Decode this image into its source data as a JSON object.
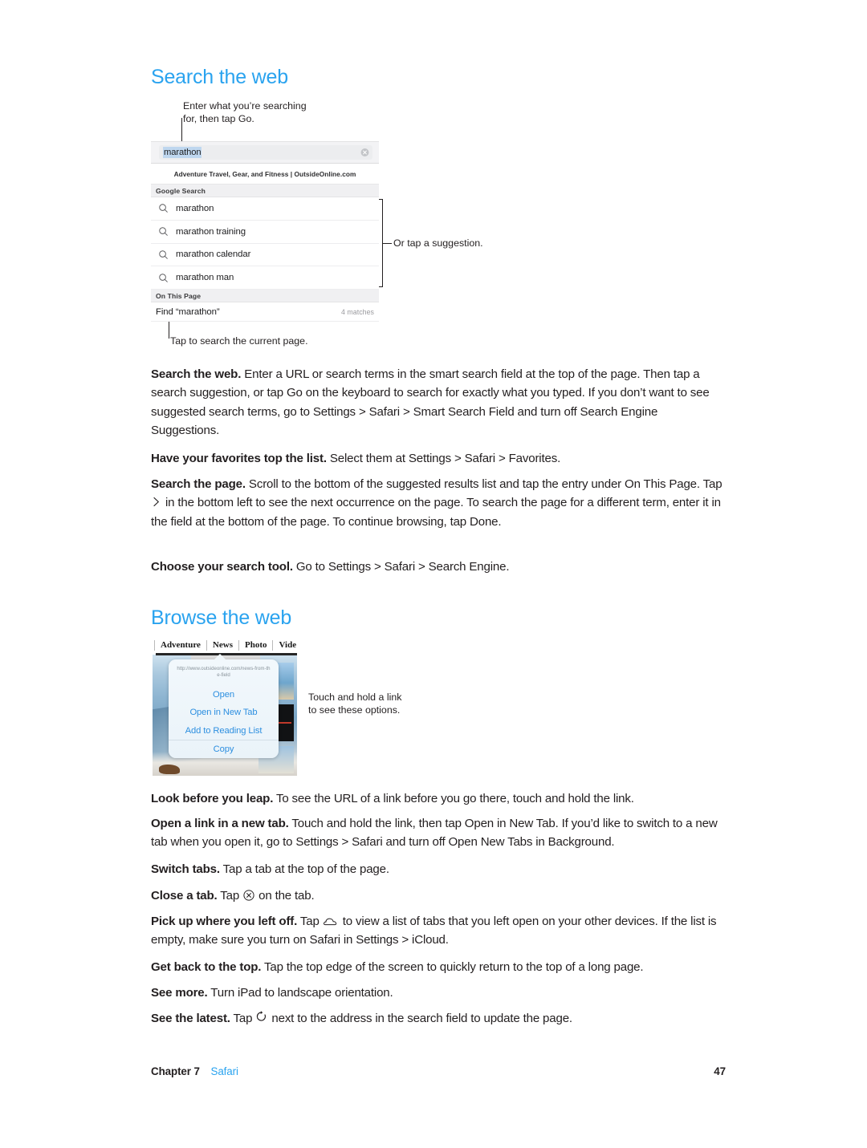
{
  "document": {
    "sections": [
      {
        "id": "search-the-web",
        "heading": "Search the web"
      },
      {
        "id": "browse-the-web",
        "heading": "Browse the web"
      }
    ]
  },
  "colors": {
    "heading_blue": "#2aa3ef",
    "link_blue": "#2d8fe0",
    "body_text": "#231f20",
    "field_gray": "#f3f3f5",
    "selection_blue": "#bfd7ef"
  },
  "figure_search": {
    "callout_top": "Enter what you’re searching\nfor, then tap Go.",
    "callout_right": "Or tap a suggestion.",
    "callout_bottom": "Tap to search the current page.",
    "search_field": {
      "value": "marathon",
      "clear_icon": "clear-circle-icon"
    },
    "banner": "Adventure Travel, Gear, and Fitness | OutsideOnline.com",
    "groups": [
      {
        "header": "Google Search",
        "rows": [
          {
            "icon": "search-icon",
            "label": "marathon"
          },
          {
            "icon": "search-icon",
            "label": "marathon training"
          },
          {
            "icon": "search-icon",
            "label": "marathon calendar"
          },
          {
            "icon": "search-icon",
            "label": "marathon man"
          }
        ]
      },
      {
        "header": "On This Page",
        "find_row": {
          "label": "Find “marathon”",
          "count": "4 matches"
        }
      }
    ]
  },
  "figure_browse": {
    "callout_right": "Touch and hold a link\nto see these options.",
    "tabs": [
      "Adventure",
      "News",
      "Photo",
      "Vide"
    ],
    "popup": {
      "url": "http://www.outsideonline.com/news-from-the-field",
      "items": [
        "Open",
        "Open in New Tab",
        "Add to Reading List",
        "Copy"
      ]
    }
  },
  "body": {
    "search_paragraphs": [
      {
        "lead": "Search the web.",
        "text": " Enter a URL or search terms in the smart search field at the top of the page. Then tap a search suggestion, or tap Go on the keyboard to search for exactly what you typed. If you don’t want to see suggested search terms, go to Settings > Safari > Smart Search Field and turn off Search Engine Suggestions."
      },
      {
        "lead": "Have your favorites top the list.",
        "text": " Select them at Settings > Safari > Favorites."
      },
      {
        "lead": "Search the page.",
        "text_before_icon": " Scroll to the bottom of the suggested results list and tap the entry under On This Page. Tap ",
        "icon": "chevron-right-icon",
        "text_after_icon": " in the bottom left to see the next occurrence on the page. To search the page for a different term, enter it in the field at the bottom of the page. To continue browsing, tap Done."
      },
      {
        "lead": "Choose your search tool.",
        "text": " Go to Settings > Safari > Search Engine."
      }
    ],
    "browse_paragraphs": [
      {
        "lead": "Look before you leap.",
        "text": " To see the URL of a link before you go there, touch and hold the link."
      },
      {
        "lead": "Open a link in a new tab.",
        "text": " Touch and hold the link, then tap Open in New Tab. If you’d like to switch to a new tab when you open it, go to Settings > Safari and turn off Open New Tabs in Background."
      },
      {
        "lead": "Switch tabs.",
        "text": " Tap a tab at the top of the page."
      },
      {
        "lead": "Close a tab.",
        "text_before_icon": " Tap ",
        "icon": "close-circle-icon",
        "text_after_icon": " on the tab."
      },
      {
        "lead": "Pick up where you left off.",
        "text_before_icon": " Tap ",
        "icon": "icloud-tabs-icon",
        "text_after_icon": " to view a list of tabs that you left open on your other devices. If the list is empty, make sure you turn on Safari in Settings > iCloud."
      },
      {
        "lead": "Get back to the top.",
        "text": " Tap the top edge of the screen to quickly return to the top of a long page."
      },
      {
        "lead": "See more.",
        "text": " Turn iPad to landscape orientation."
      },
      {
        "lead": "See the latest.",
        "text_before_icon": " Tap ",
        "icon": "reload-icon",
        "text_after_icon": " next to the address in the search field to update the page."
      }
    ]
  },
  "footer": {
    "chapter": "Chapter  7",
    "section": "Safari",
    "page_number": "47"
  }
}
